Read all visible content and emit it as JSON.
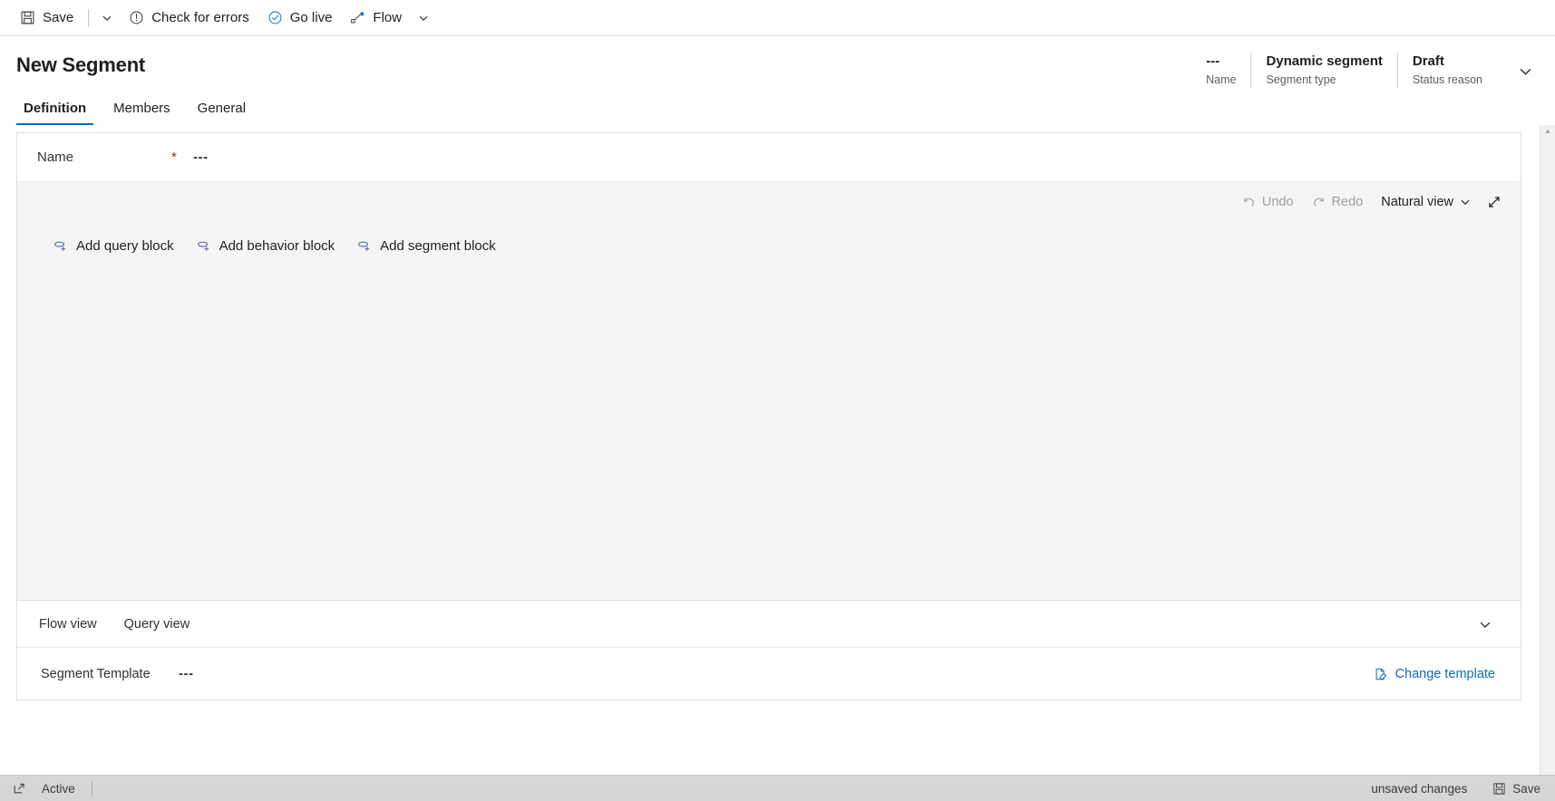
{
  "commandbar": {
    "items": [
      {
        "label": "Save",
        "icon": "save-icon",
        "has_chevron": true
      },
      {
        "label": "Check for errors",
        "icon": "error-circle-icon",
        "has_chevron": false
      },
      {
        "label": "Go live",
        "icon": "check-circle-icon",
        "has_chevron": false
      },
      {
        "label": "Flow",
        "icon": "flow-icon",
        "has_chevron": true
      }
    ]
  },
  "header": {
    "title": "New Segment",
    "fields": [
      {
        "value": "---",
        "label": "Name"
      },
      {
        "value": "Dynamic segment",
        "label": "Segment type"
      },
      {
        "value": "Draft",
        "label": "Status reason"
      }
    ],
    "expand_icon": "chevron-down-icon"
  },
  "tabs": [
    {
      "label": "Definition",
      "active": true
    },
    {
      "label": "Members",
      "active": false
    },
    {
      "label": "General",
      "active": false
    }
  ],
  "form": {
    "name_field": {
      "label": "Name",
      "required_marker": "*",
      "value": "---"
    }
  },
  "canvas": {
    "toolbar": [
      {
        "label": "Undo",
        "icon": "undo-icon",
        "disabled": true
      },
      {
        "label": "Redo",
        "icon": "redo-icon",
        "disabled": true
      },
      {
        "label": "Natural view",
        "icon": "chevron-down-icon",
        "disabled": false
      }
    ],
    "expand_icon": "expand-diagonal-icon",
    "add_blocks": [
      {
        "label": "Add query block",
        "icon": "add-query-icon"
      },
      {
        "label": "Add behavior block",
        "icon": "add-behavior-icon"
      },
      {
        "label": "Add segment block",
        "icon": "add-segment-icon"
      }
    ]
  },
  "footer": {
    "view_tabs": [
      {
        "label": "Flow view"
      },
      {
        "label": "Query view"
      }
    ],
    "collapse_icon": "chevron-down-icon",
    "template": {
      "label": "Segment Template",
      "value": "---",
      "change_label": "Change template",
      "change_icon": "edit-page-icon"
    }
  },
  "scrollbar": {
    "up_arrow": "▲",
    "down_arrow": "▼"
  },
  "statusbar": {
    "popout_icon": "popout-icon",
    "status": "Active",
    "unsaved_text": "unsaved changes",
    "save_label": "Save",
    "save_icon": "save-icon"
  },
  "colors": {
    "accent": "#0f6cbd",
    "required": "#a4262c",
    "canvas_bg": "#f5f5f5",
    "statusbar_bg": "#d6d6d6",
    "block_icon": "#5b5fc7"
  }
}
